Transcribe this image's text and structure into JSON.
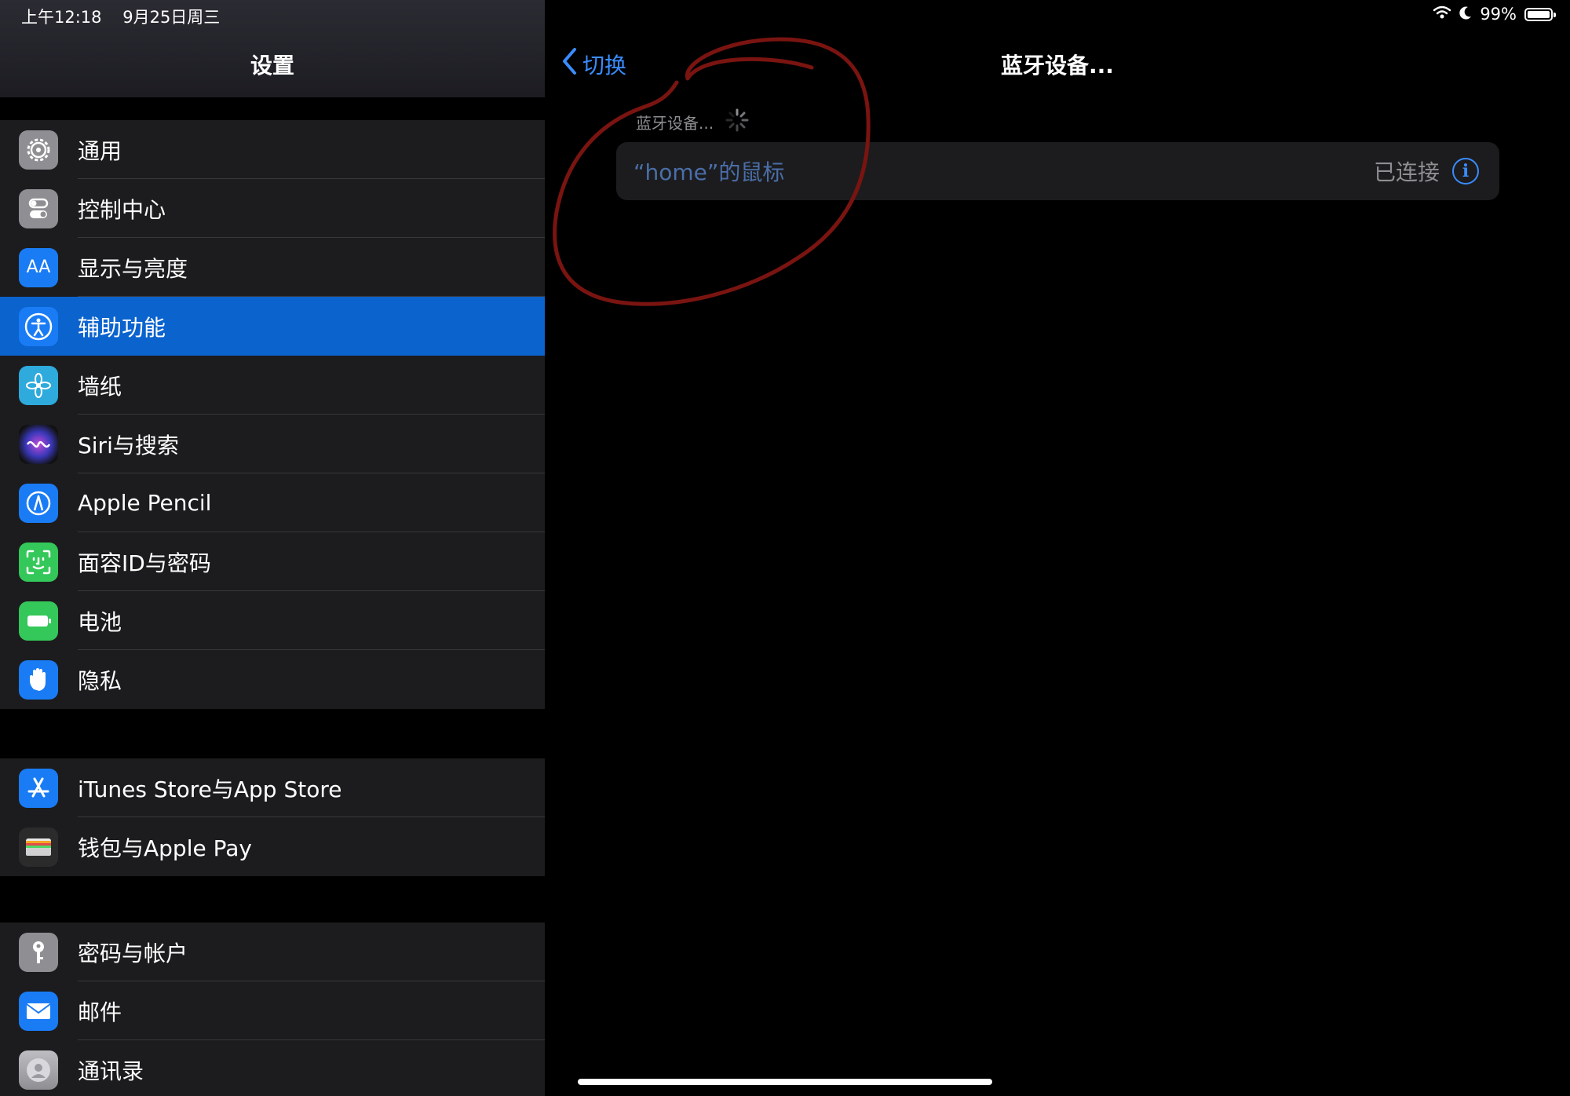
{
  "status_bar": {
    "time": "上午12:18",
    "date": "9月25日周三",
    "battery_percent": "99%",
    "battery_level": 0.99
  },
  "sidebar": {
    "title": "设置",
    "groups": [
      {
        "items": [
          {
            "label": "通用",
            "icon": "gear-icon",
            "color": "#8e8e93"
          },
          {
            "label": "控制中心",
            "icon": "toggles-icon",
            "color": "#8e8e93"
          },
          {
            "label": "显示与亮度",
            "icon": "text-size-icon",
            "icon_text": "AA",
            "color": "#1a7cf5"
          },
          {
            "label": "辅助功能",
            "icon": "accessibility-icon",
            "color": "#1a7cf5",
            "selected": true
          },
          {
            "label": "墙纸",
            "icon": "flower-icon",
            "color": "#2eaadc"
          },
          {
            "label": "Siri与搜索",
            "icon": "siri-icon",
            "color": "#3a38b9"
          },
          {
            "label": "Apple Pencil",
            "icon": "pencil-icon",
            "color": "#1a7cf5"
          },
          {
            "label": "面容ID与密码",
            "icon": "face-id-icon",
            "color": "#34c759"
          },
          {
            "label": "电池",
            "icon": "battery-icon",
            "color": "#34c759"
          },
          {
            "label": "隐私",
            "icon": "hand-icon",
            "color": "#1a7cf5"
          }
        ]
      },
      {
        "items": [
          {
            "label": "iTunes Store与App Store",
            "icon": "app-store-icon",
            "color": "#1a7cf5"
          },
          {
            "label": "钱包与Apple Pay",
            "icon": "wallet-icon",
            "color": "#2b2b2b"
          }
        ]
      },
      {
        "items": [
          {
            "label": "密码与帐户",
            "icon": "key-icon",
            "color": "#8e8e93"
          },
          {
            "label": "邮件",
            "icon": "mail-icon",
            "color": "#1a7cf5"
          },
          {
            "label": "通讯录",
            "icon": "contacts-icon",
            "color": "#8e8e93"
          }
        ]
      }
    ]
  },
  "detail": {
    "back_label": "切换",
    "title": "蓝牙设备...",
    "section_header": "蓝牙设备...",
    "devices": [
      {
        "name": "“home”的鼠标",
        "status": "已连接"
      }
    ]
  },
  "colors": {
    "accent": "#3a8cff",
    "selection": "#0b63ce",
    "annotation_stroke": "#7a1410"
  }
}
